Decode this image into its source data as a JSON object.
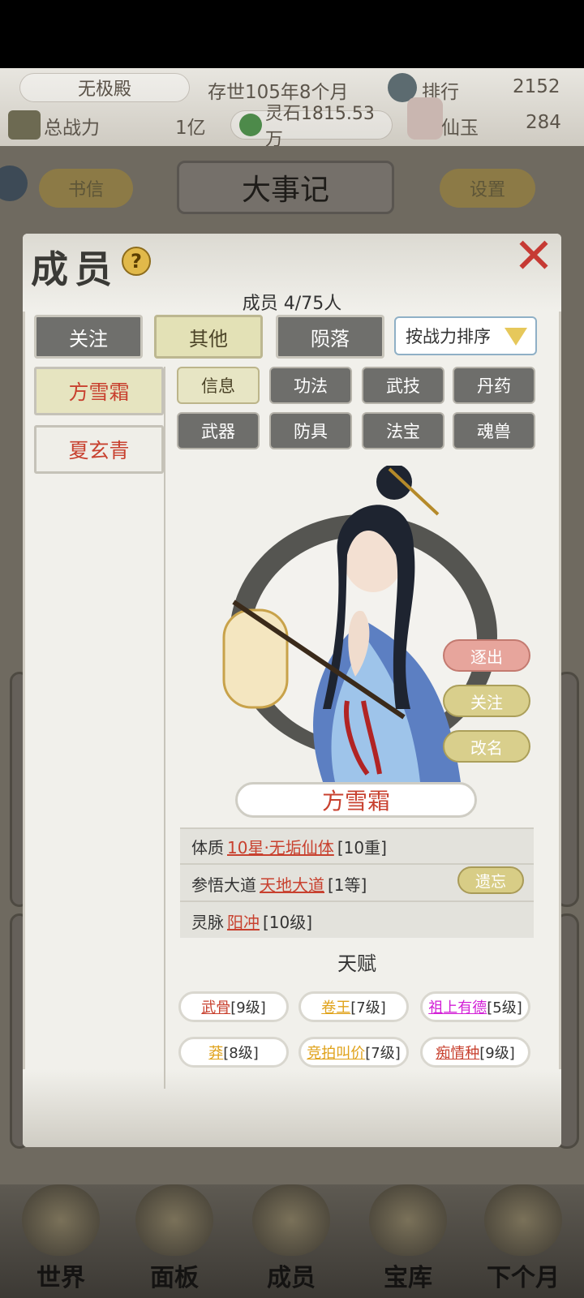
{
  "header": {
    "sect_name": "无极殿",
    "age": "存世105年8个月",
    "rank_label": "排行",
    "rank_value": "2152",
    "power_label": "总战力",
    "power_value": "1亿",
    "spirit_stone": "灵石1815.53万",
    "jade_label": "仙玉",
    "jade_value": "284"
  },
  "background": {
    "letters_label": "书信",
    "events_title": "大事记",
    "settings_label": "设置"
  },
  "modal": {
    "title": "成员",
    "member_count": "成员  4/75人",
    "group_tabs": [
      {
        "label": "关注",
        "active": false
      },
      {
        "label": "其他",
        "active": true
      },
      {
        "label": "陨落",
        "active": false
      }
    ],
    "sort_label": "按战力排序",
    "members": [
      {
        "name": "方雪霜",
        "active": true
      },
      {
        "name": "夏玄青",
        "active": false
      }
    ],
    "categories": [
      {
        "label": "信息",
        "active": true
      },
      {
        "label": "功法",
        "active": false
      },
      {
        "label": "武技",
        "active": false
      },
      {
        "label": "丹药",
        "active": false
      },
      {
        "label": "武器",
        "active": false
      },
      {
        "label": "防具",
        "active": false
      },
      {
        "label": "法宝",
        "active": false
      },
      {
        "label": "魂兽",
        "active": false
      }
    ],
    "actions": {
      "expel": "逐出",
      "follow": "关注",
      "rename": "改名"
    },
    "selected_name": "方雪霜",
    "attributes": {
      "physique_label": "体质",
      "physique_value": "10星·无垢仙体",
      "physique_level": "[10重]",
      "dao_label": "参悟大道",
      "dao_value": "天地大道",
      "dao_level": "[1等]",
      "forget_label": "遗忘",
      "vein_label": "灵脉",
      "vein_value": "阳冲",
      "vein_level": "[10级]"
    },
    "talent_title": "天赋",
    "talents": [
      {
        "name": "武骨",
        "level": "[9级]",
        "color": "#c8412f"
      },
      {
        "name": "卷王",
        "level": "[7级]",
        "color": "#e0a21a"
      },
      {
        "name": "祖上有德",
        "level": "[5级]",
        "color": "#d21fd6"
      },
      {
        "name": "莽",
        "level": "[8级]",
        "color": "#e0a21a"
      },
      {
        "name": "竞拍叫价",
        "level": "[7级]",
        "color": "#e0a21a"
      },
      {
        "name": "痴情种",
        "level": "[9级]",
        "color": "#c8412f"
      }
    ]
  },
  "bottom_nav": [
    "世界",
    "面板",
    "成员",
    "宝库",
    "下个月"
  ]
}
